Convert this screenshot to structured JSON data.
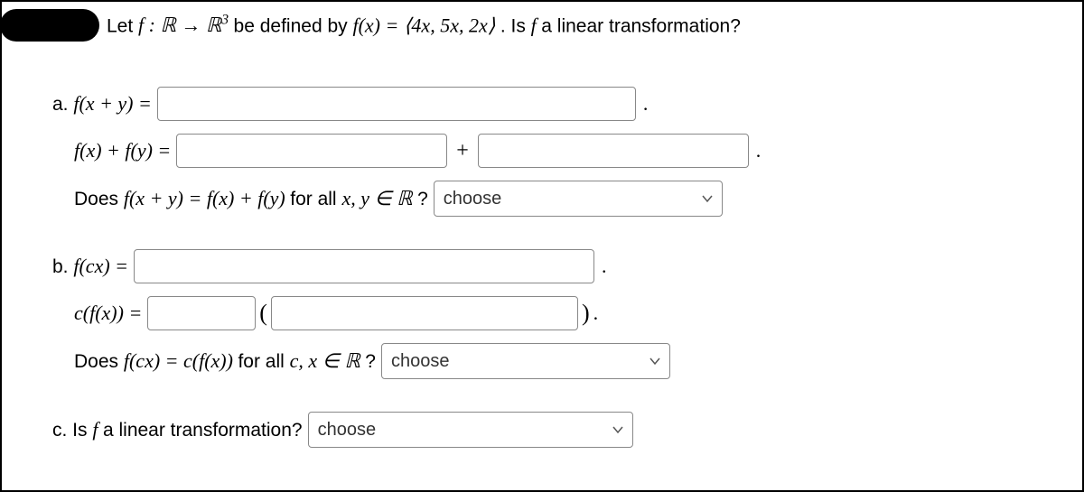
{
  "prompt": {
    "pre": "Let ",
    "fdef1": "f : ℝ → ℝ",
    "sup": "3",
    "mid": " be defined by ",
    "fx": "f(x) = ⟨4x, 5x, 2x⟩",
    "post": ". Is ",
    "fname": "f",
    "tail": " a linear transformation?"
  },
  "a": {
    "label": "a. ",
    "lhs1": "f(x + y) = ",
    "lhs2": "f(x) + f(y) = ",
    "plus": "+",
    "dot": ".",
    "q_pre": "Does ",
    "q_math": "f(x + y) = f(x) + f(y)",
    "q_mid": " for all ",
    "q_set": "x, y ∈ ℝ",
    "q_tail": "?"
  },
  "b": {
    "label": "b. ",
    "lhs1": "f(cx) = ",
    "lhs2": "c(f(x)) = ",
    "lparen": "(",
    "rparen": ")",
    "dot": ".",
    "q_pre": "Does ",
    "q_math": "f(cx) = c(f(x))",
    "q_mid": " for all ",
    "q_set": "c, x ∈ ℝ",
    "q_tail": "?"
  },
  "c": {
    "label": "c. Is ",
    "fname": "f",
    "tail": " a linear transformation?"
  },
  "select": {
    "placeholder": "choose"
  }
}
